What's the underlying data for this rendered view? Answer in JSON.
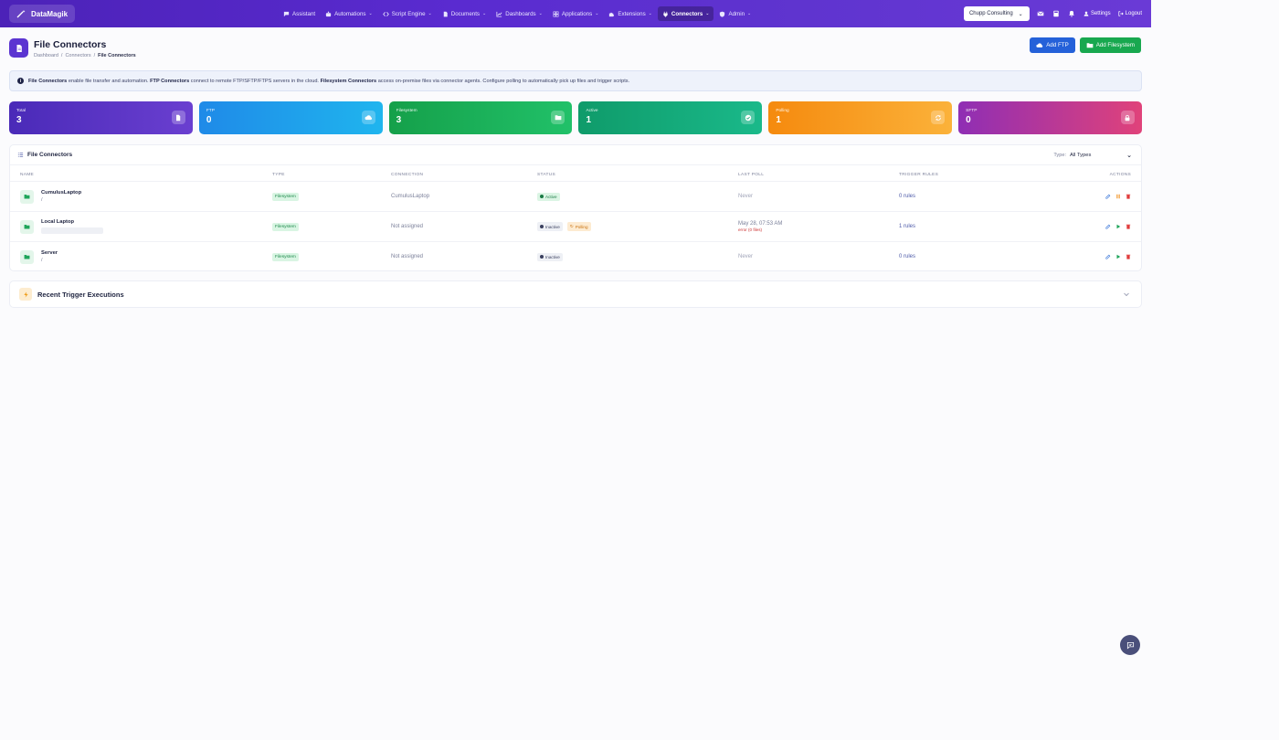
{
  "brand": {
    "name": "DataMagik"
  },
  "nav": {
    "items": [
      {
        "label": "Assistant",
        "icon": "chat-icon",
        "caret": false
      },
      {
        "label": "Automations",
        "icon": "robot-icon",
        "caret": true
      },
      {
        "label": "Script Engine",
        "icon": "code-icon",
        "caret": true
      },
      {
        "label": "Documents",
        "icon": "document-icon",
        "caret": true
      },
      {
        "label": "Dashboards",
        "icon": "chart-icon",
        "caret": true
      },
      {
        "label": "Applications",
        "icon": "grid-icon",
        "caret": true
      },
      {
        "label": "Extensions",
        "icon": "puzzle-icon",
        "caret": true
      },
      {
        "label": "Connectors",
        "icon": "plug-icon",
        "caret": true,
        "active": true
      },
      {
        "label": "Admin",
        "icon": "shield-icon",
        "caret": true
      }
    ],
    "org": "Chupp Consulting",
    "settings": "Settings",
    "logout": "Logout"
  },
  "header": {
    "title": "File Connectors",
    "breadcrumb": [
      "Dashboard",
      "Connectors",
      "File Connectors"
    ],
    "add_ftp": "Add FTP",
    "add_fs": "Add Filesystem"
  },
  "info": {
    "b1": "File Connectors",
    "t1": "enable file transfer and automation.",
    "b2": "FTP Connectors",
    "t2": "connect to remote FTP/SFTP/FTPS servers in the cloud.",
    "b3": "Filesystem Connectors",
    "t3": "access on-premise files via connector agents. Configure polling to automatically pick up files and trigger scripts."
  },
  "stats": [
    {
      "label": "Total",
      "value": "3",
      "icon": "document-icon"
    },
    {
      "label": "FTP",
      "value": "0",
      "icon": "cloud-icon"
    },
    {
      "label": "Filesystem",
      "value": "3",
      "icon": "folder-icon"
    },
    {
      "label": "Active",
      "value": "1",
      "icon": "check-circle-icon"
    },
    {
      "label": "Polling",
      "value": "1",
      "icon": "sync-icon"
    },
    {
      "label": "SFTP",
      "value": "0",
      "icon": "lock-icon"
    }
  ],
  "table": {
    "title": "File Connectors",
    "type_label": "Type:",
    "type_value": "All Types",
    "columns": [
      "NAME",
      "TYPE",
      "CONNECTION",
      "STATUS",
      "LAST POLL",
      "TRIGGER RULES",
      "ACTIONS"
    ],
    "rows": [
      {
        "name": "CumulusLaptop",
        "path": "/",
        "type": "Filesystem",
        "connection": "CumulusLaptop",
        "status": "Active",
        "polling": "",
        "last_poll": "Never",
        "last_poll_sub": "",
        "rules": "0 rules"
      },
      {
        "name": "Local Laptop",
        "path": "",
        "type": "Filesystem",
        "connection": "Not assigned",
        "status": "Inactive",
        "polling": "Polling",
        "last_poll": "May 28, 07:53 AM",
        "last_poll_sub": "error (0 files)",
        "rules": "1 rules"
      },
      {
        "name": "Server",
        "path": "/",
        "type": "Filesystem",
        "connection": "Not assigned",
        "status": "Inactive",
        "polling": "",
        "last_poll": "Never",
        "last_poll_sub": "",
        "rules": "0 rules"
      }
    ]
  },
  "recent": {
    "title": "Recent Trigger Executions"
  },
  "colors": {
    "primary": "#5b34d1",
    "blue": "#2461d9",
    "green": "#18a84f"
  }
}
